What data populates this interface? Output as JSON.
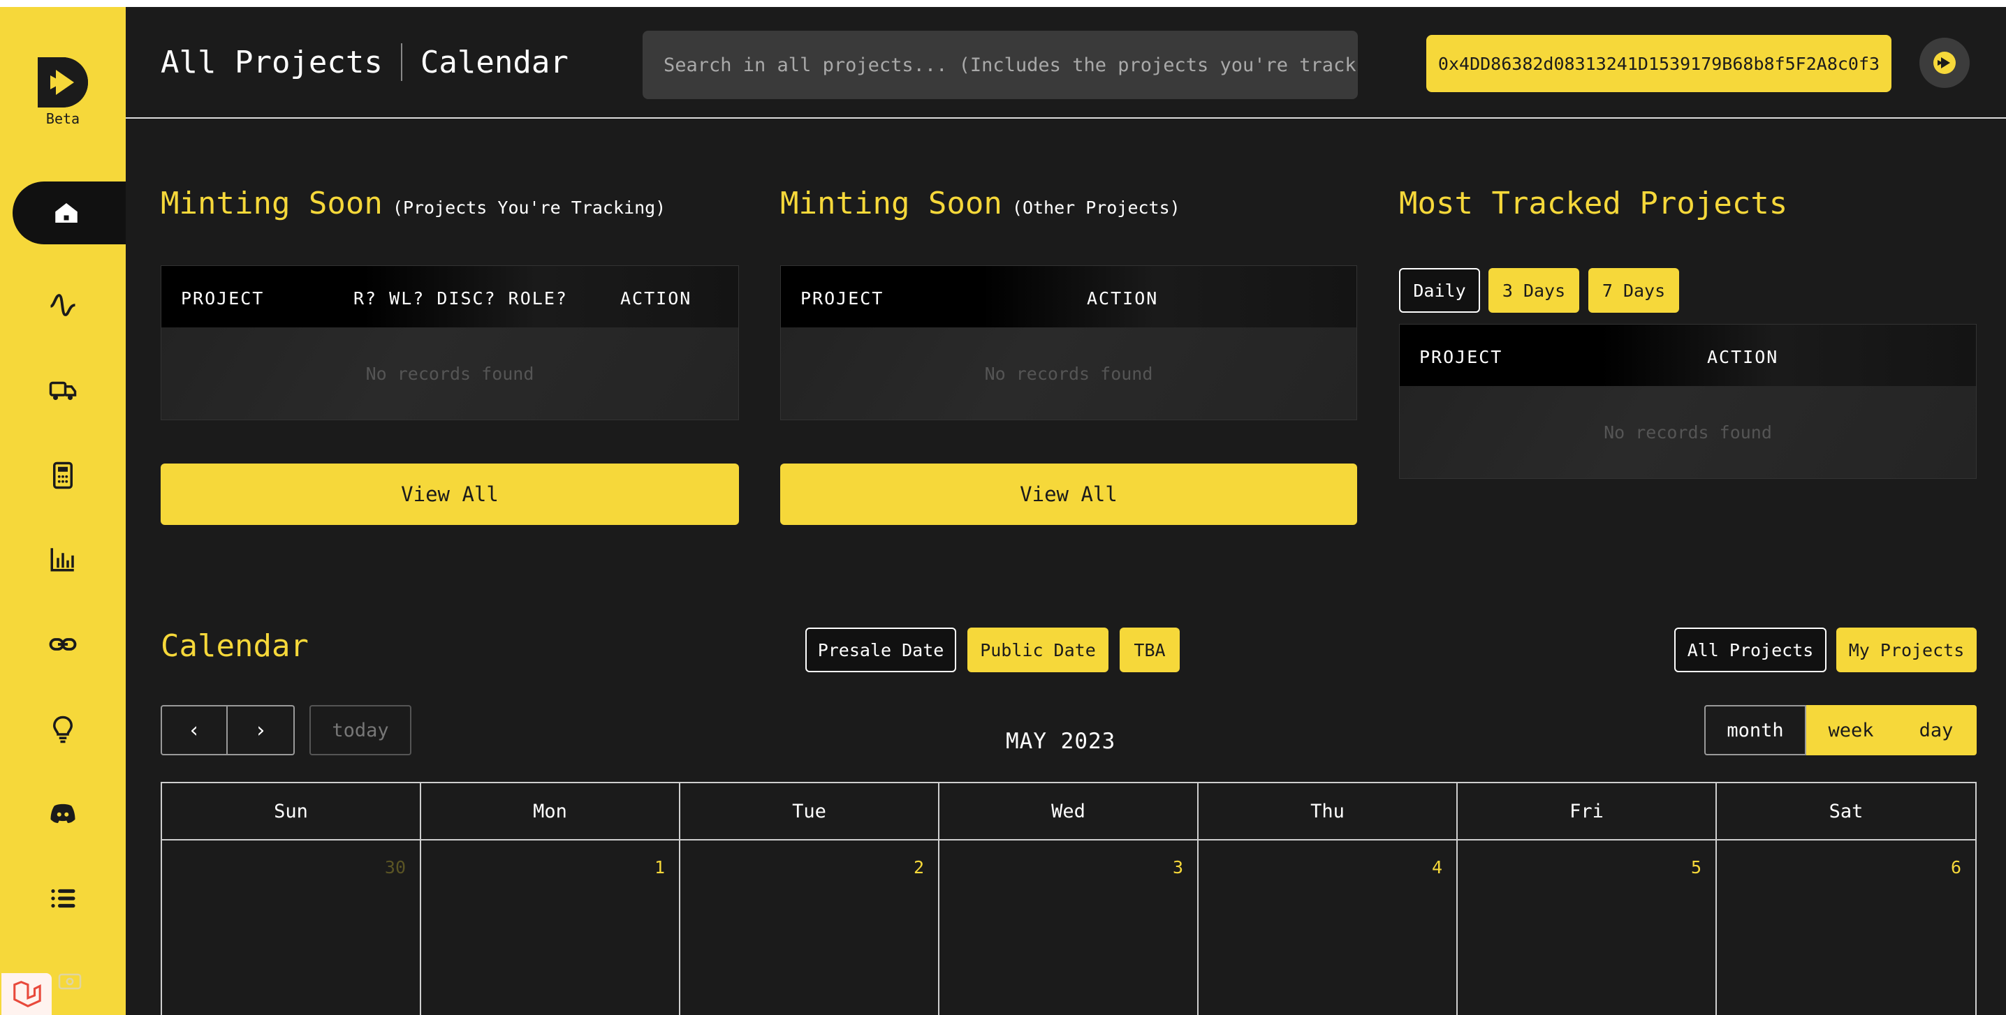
{
  "sidebar": {
    "logo_text": "Beta",
    "items": [
      {
        "icon": "home-icon",
        "active": true
      },
      {
        "icon": "activity-icon"
      },
      {
        "icon": "truck-icon"
      },
      {
        "icon": "calculator-icon"
      },
      {
        "icon": "bar-chart-icon"
      },
      {
        "icon": "link-icon"
      },
      {
        "icon": "lightbulb-icon"
      },
      {
        "icon": "discord-icon"
      },
      {
        "icon": "list-icon"
      }
    ]
  },
  "header": {
    "breadcrumb_1": "All Projects",
    "breadcrumb_2": "Calendar",
    "search_placeholder": "Search in all projects... (Includes the projects you're tracking)",
    "wallet_address": "0x4DD86382d08313241D1539179B68b8f5F2A8c0f3"
  },
  "panels": {
    "tracking": {
      "title": "Minting Soon",
      "subtitle": "(Projects You're Tracking)",
      "columns": [
        "PROJECT",
        "R? WL? DISC? ROLE?",
        "ACTION"
      ],
      "empty": "No records found",
      "button": "View All"
    },
    "other": {
      "title": "Minting Soon",
      "subtitle": "(Other Projects)",
      "columns": [
        "PROJECT",
        "ACTION"
      ],
      "empty": "No records found",
      "button": "View All"
    },
    "tracked": {
      "title": "Most Tracked Projects",
      "filters": [
        "Daily",
        "3 Days",
        "7 Days"
      ],
      "columns": [
        "PROJECT",
        "ACTION"
      ],
      "empty": "No records found"
    }
  },
  "calendar": {
    "title": "Calendar",
    "date_filters": [
      "Presale Date",
      "Public Date",
      "TBA"
    ],
    "scope_filters": [
      "All Projects",
      "My Projects"
    ],
    "prev": "‹",
    "next": "›",
    "today": "today",
    "month_label": "MAY 2023",
    "views": [
      "month",
      "week",
      "day"
    ],
    "weekdays": [
      "Sun",
      "Mon",
      "Tue",
      "Wed",
      "Thu",
      "Fri",
      "Sat"
    ],
    "dates": [
      "30",
      "1",
      "2",
      "3",
      "4",
      "5",
      "6"
    ]
  },
  "colors": {
    "accent": "#f6d83a",
    "background": "#1b1b1b"
  }
}
